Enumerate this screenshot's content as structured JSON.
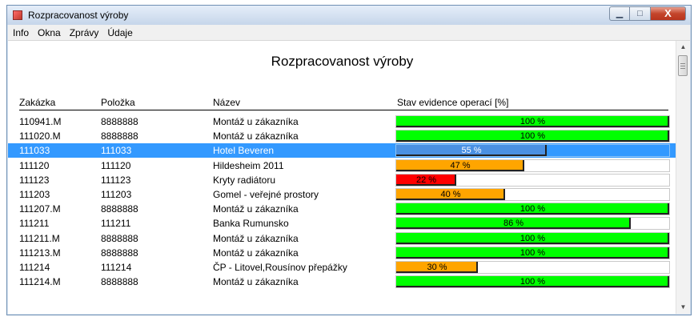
{
  "window": {
    "title": "Rozpracovanost výroby"
  },
  "window_controls": {
    "minimize": "▁",
    "maximize": "□",
    "close": "X"
  },
  "menu": [
    "Info",
    "Okna",
    "Zprávy",
    "Údaje"
  ],
  "report": {
    "title": "Rozpracovanost výroby",
    "columns": {
      "zakazka": "Zakázka",
      "polozka": "Položka",
      "nazev": "Název",
      "stav": "Stav evidence operací [%]"
    },
    "rows": [
      {
        "zakazka": "110941.M",
        "polozka": "8888888",
        "nazev": "Montáž u zákazníka",
        "progress": 1.0,
        "label": "100 %",
        "color": "#00ff00"
      },
      {
        "zakazka": "111020.M",
        "polozka": "8888888",
        "nazev": "Montáž u zákazníka",
        "progress": 1.0,
        "label": "100 %",
        "color": "#00ff00"
      },
      {
        "zakazka": "111033",
        "polozka": "111033",
        "nazev": "Hotel Beveren",
        "progress": 0.55,
        "label": "55 %",
        "color": "#4a90e2",
        "selected": true
      },
      {
        "zakazka": "111120",
        "polozka": "111120",
        "nazev": "Hildesheim 2011",
        "progress": 0.47,
        "label": "47 %",
        "color": "#ffa500"
      },
      {
        "zakazka": "111123",
        "polozka": "111123",
        "nazev": "Kryty radiátoru",
        "progress": 0.22,
        "label": "22 %",
        "color": "#ff0000"
      },
      {
        "zakazka": "111203",
        "polozka": "111203",
        "nazev": "Gomel - veřejné prostory",
        "progress": 0.4,
        "label": "40 %",
        "color": "#ffa500"
      },
      {
        "zakazka": "111207.M",
        "polozka": "8888888",
        "nazev": "Montáž u zákazníka",
        "progress": 1.0,
        "label": "100 %",
        "color": "#00ff00"
      },
      {
        "zakazka": "111211",
        "polozka": "111211",
        "nazev": "Banka Rumunsko",
        "progress": 0.86,
        "label": "86 %",
        "color": "#00ff00"
      },
      {
        "zakazka": "111211.M",
        "polozka": "8888888",
        "nazev": "Montáž u zákazníka",
        "progress": 1.0,
        "label": "100 %",
        "color": "#00ff00"
      },
      {
        "zakazka": "111213.M",
        "polozka": "8888888",
        "nazev": "Montáž u zákazníka",
        "progress": 1.0,
        "label": "100 %",
        "color": "#00ff00"
      },
      {
        "zakazka": "111214",
        "polozka": "111214",
        "nazev": "ČP - Litovel,Rousínov přepážky",
        "progress": 0.3,
        "label": "30 %",
        "color": "#ffa500"
      },
      {
        "zakazka": "111214.M",
        "polozka": "8888888",
        "nazev": "Montáž u zákazníka",
        "progress": 1.0,
        "label": "100 %",
        "color": "#00ff00"
      }
    ]
  }
}
